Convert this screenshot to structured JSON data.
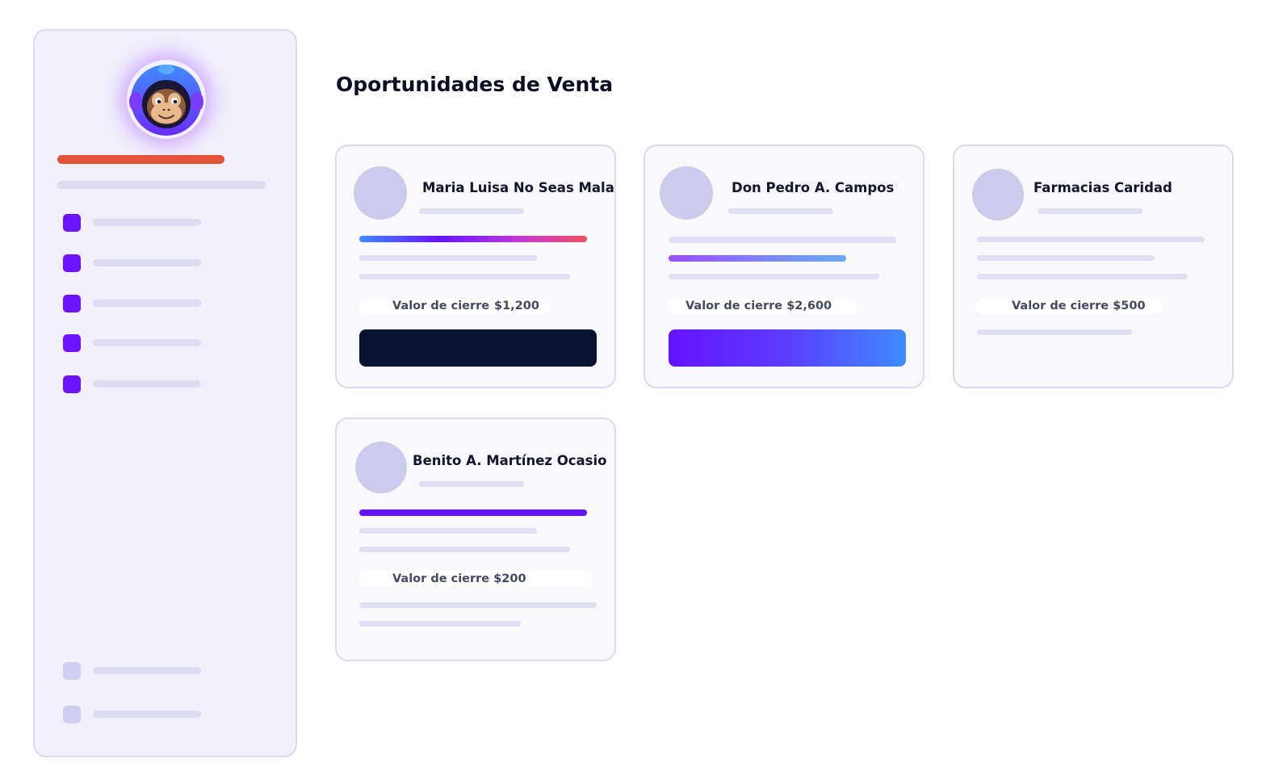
{
  "page": {
    "title": "Oportunidades de Venta"
  },
  "sidebar": {
    "logo_icon": "monkey-astronaut-icon",
    "accent_color": "#e5533d",
    "items_color": "#6a14ff",
    "nav_count_primary": 5,
    "nav_count_secondary": 2
  },
  "cards": [
    {
      "name": "Maria Luisa No Seas Mala",
      "value_label": "Valor de cierre",
      "value_amount": "$1,200",
      "action_style": "dark"
    },
    {
      "name": "Don Pedro A. Campos",
      "value_text": "Valor de cierre $2,600",
      "action_style": "gradient"
    },
    {
      "name": "Farmacias Caridad",
      "value_text": "Valor de cierre $500"
    },
    {
      "name": "Benito A. Martínez Ocasio",
      "value_text": "Valor de cierre $200"
    }
  ],
  "colors": {
    "dark_button": "#081331",
    "gradient_start": "#6512ff",
    "gradient_end": "#3f8cff",
    "progress_purple": "#6a14ff",
    "progress_red": "#ea4f6a"
  }
}
